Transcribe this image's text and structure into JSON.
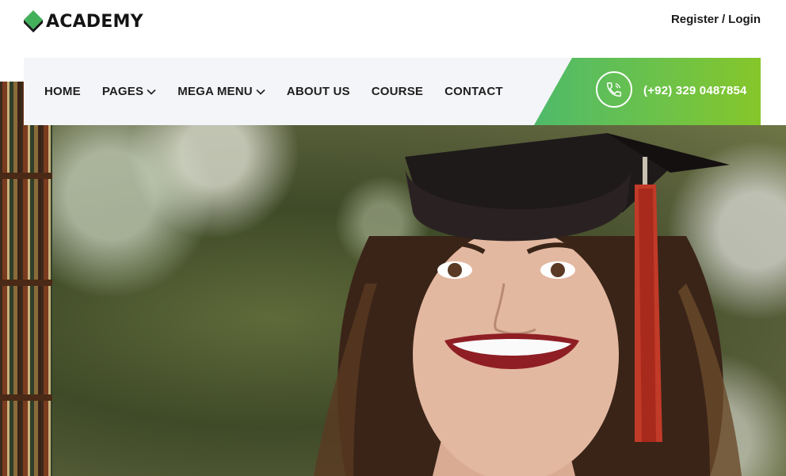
{
  "brand": {
    "name": "ACADEMY",
    "mark_color": "#43b05c"
  },
  "header": {
    "register_label": "Register",
    "separator": "/",
    "login_label": "Login"
  },
  "nav": {
    "items": [
      {
        "label": "HOME",
        "has_dropdown": false
      },
      {
        "label": "PAGES",
        "has_dropdown": true
      },
      {
        "label": "MEGA MENU",
        "has_dropdown": true
      },
      {
        "label": "ABOUT US",
        "has_dropdown": false
      },
      {
        "label": "COURSE",
        "has_dropdown": false
      },
      {
        "label": "CONTACT",
        "has_dropdown": false
      }
    ]
  },
  "contact": {
    "phone": "(+92) 329 0487854",
    "icon": "phone-icon",
    "accent_gradient": [
      "#4fba6a",
      "#86c62a"
    ]
  },
  "hero": {
    "image_alt": "graduate-student-photo",
    "icon": "graduation-cap"
  }
}
